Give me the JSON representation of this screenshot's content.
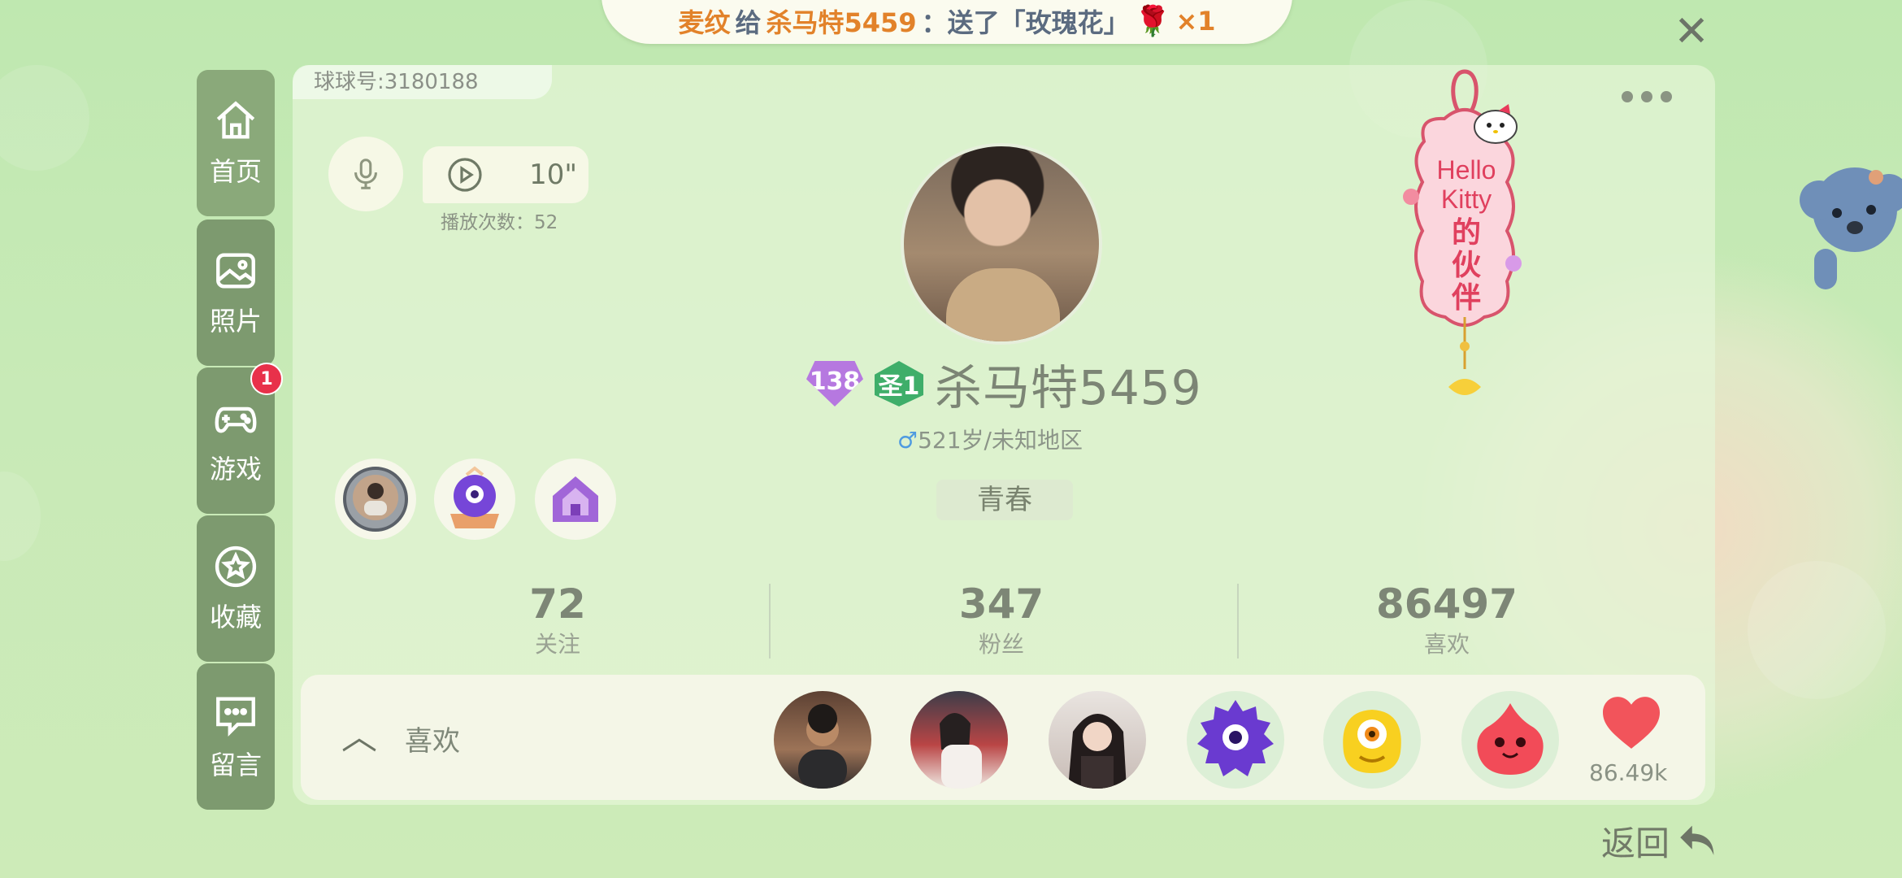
{
  "banner": {
    "sender": "麦纹",
    "give": "给",
    "receiver": "杀马特5459",
    "sent": "：送了「玫瑰花」",
    "count": "×1"
  },
  "nav": [
    {
      "id": "home",
      "label": "首页",
      "icon": "home-icon",
      "active": true
    },
    {
      "id": "photos",
      "label": "照片",
      "icon": "image-icon"
    },
    {
      "id": "games",
      "label": "游戏",
      "icon": "gamepad-icon",
      "badge": "1"
    },
    {
      "id": "favorites",
      "label": "收藏",
      "icon": "star-icon"
    },
    {
      "id": "messages",
      "label": "留言",
      "icon": "chat-icon"
    }
  ],
  "profile": {
    "uid_label": "球球号:3180188",
    "voice_duration": "10\"",
    "play_count": "播放次数：52",
    "level": "138",
    "saint_badge": "圣1",
    "nickname": "杀马特5459",
    "gender_symbol": "♂",
    "age_region": "521岁/未知地区",
    "tag": "青春"
  },
  "stats": [
    {
      "value": "72",
      "label": "关注"
    },
    {
      "value": "347",
      "label": "粉丝"
    },
    {
      "value": "86497",
      "label": "喜欢"
    }
  ],
  "likes_bar": {
    "label": "喜欢",
    "count": "86.49k"
  },
  "kitty_badge": {
    "line1": "Hello",
    "line2": "Kitty",
    "line3": "的",
    "line4": "伙",
    "line5": "伴"
  },
  "back_label": "返回",
  "colors": {
    "nav_bg": "#7d9a6f",
    "accent_orange": "#e2822a",
    "heart": "#f2545b",
    "level": "#b678e0"
  }
}
